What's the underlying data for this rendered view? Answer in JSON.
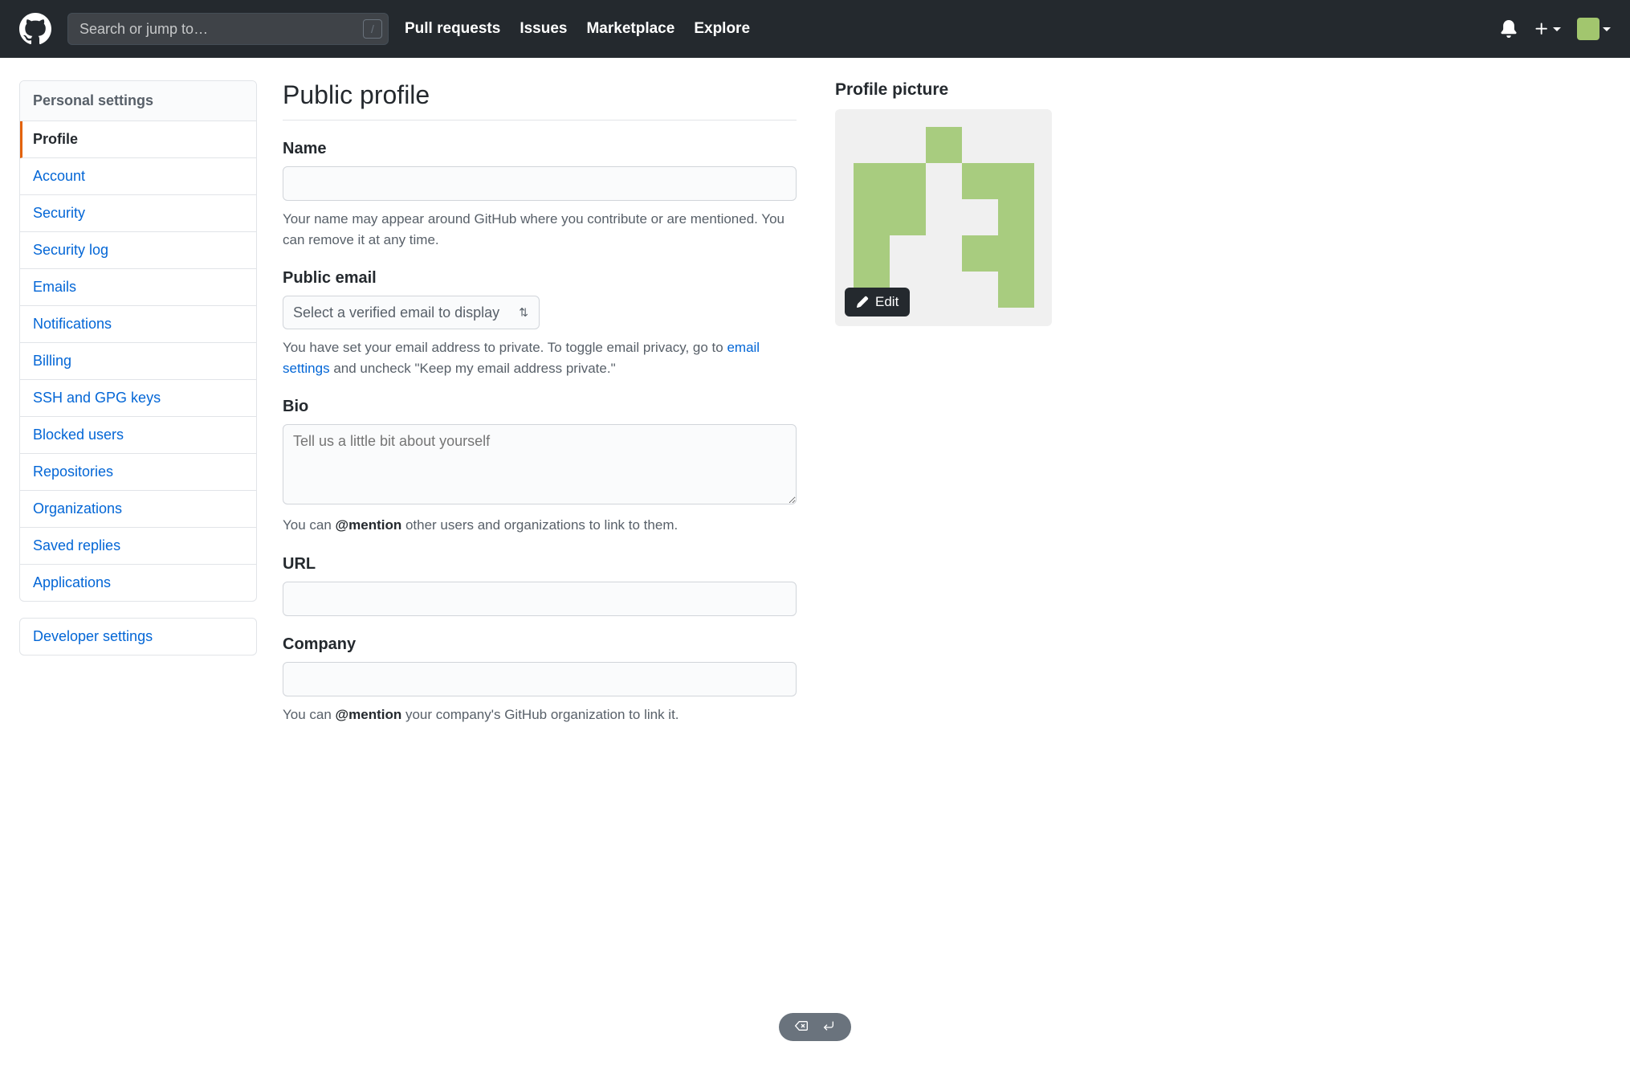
{
  "header": {
    "search_placeholder": "Search or jump to…",
    "slash": "/",
    "nav": [
      "Pull requests",
      "Issues",
      "Marketplace",
      "Explore"
    ]
  },
  "sidebar": {
    "header": "Personal settings",
    "items": [
      {
        "label": "Profile",
        "active": true
      },
      {
        "label": "Account"
      },
      {
        "label": "Security"
      },
      {
        "label": "Security log"
      },
      {
        "label": "Emails"
      },
      {
        "label": "Notifications"
      },
      {
        "label": "Billing"
      },
      {
        "label": "SSH and GPG keys"
      },
      {
        "label": "Blocked users"
      },
      {
        "label": "Repositories"
      },
      {
        "label": "Organizations"
      },
      {
        "label": "Saved replies"
      },
      {
        "label": "Applications"
      }
    ],
    "dev_header": "Developer settings"
  },
  "page": {
    "title": "Public profile",
    "name": {
      "label": "Name",
      "value": "",
      "note": "Your name may appear around GitHub where you contribute or are mentioned. You can remove it at any time."
    },
    "email": {
      "label": "Public email",
      "selected": "Select a verified email to display",
      "note_pre": "You have set your email address to private. To toggle email privacy, go to ",
      "note_link": "email settings",
      "note_post": " and uncheck \"Keep my email address private.\""
    },
    "bio": {
      "label": "Bio",
      "placeholder": "Tell us a little bit about yourself",
      "value": "",
      "note_pre": "You can ",
      "note_strong": "@mention",
      "note_post": " other users and organizations to link to them."
    },
    "url": {
      "label": "URL",
      "value": ""
    },
    "company": {
      "label": "Company",
      "value": "",
      "note_pre": "You can ",
      "note_strong": "@mention",
      "note_post": " your company's GitHub organization to link it."
    },
    "picture": {
      "label": "Profile picture",
      "edit": "Edit"
    }
  }
}
